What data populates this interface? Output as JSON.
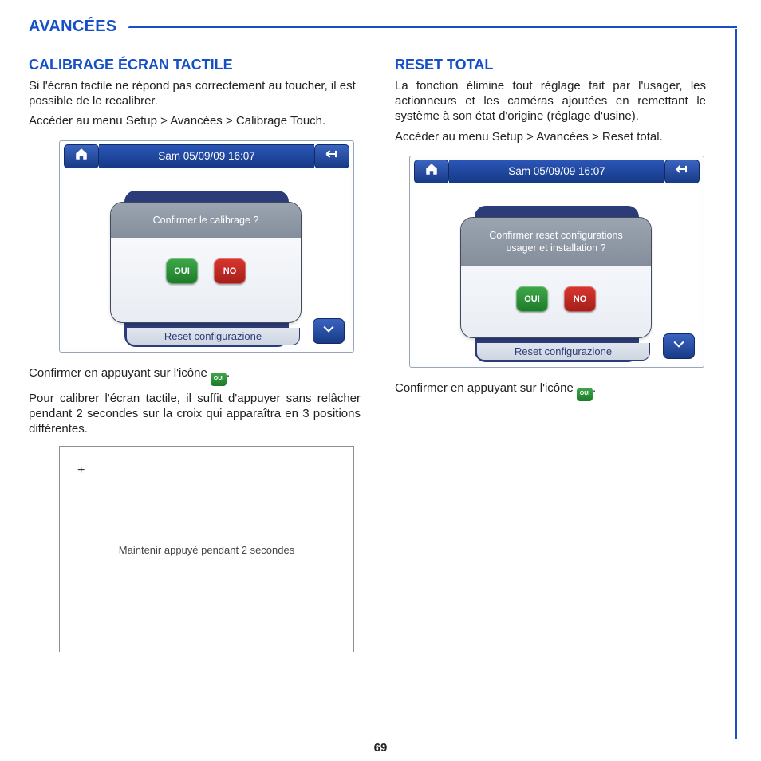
{
  "sectionTitle": "AVANCÉES",
  "pageNumber": "69",
  "left": {
    "heading": "CALIBRAGE ÉCRAN TACTILE",
    "para1": "Si l'écran tactile ne répond pas correctement au toucher, il est possible de le recalibrer.",
    "para2": "Accéder au menu Setup > Avancées > Calibrage Touch.",
    "device": {
      "dateTime": "Sam 05/09/09 16:07",
      "dialogMsg": "Confirmer le calibrage ?",
      "ouiLabel": "OUI",
      "noLabel": "NO",
      "bottomLabel": "Reset configurazione"
    },
    "confirmPrefix": "Confirmer en appuyant sur l'icône ",
    "confirmSuffix": ".",
    "inlineIconLabel": "OUI",
    "para3": "Pour calibrer l'écran tactile, il suffit d'appuyer sans relâcher pendant 2 secondes sur la croix qui apparaîtra en 3 positions différentes.",
    "calibBox": {
      "cross": "+",
      "hold": "Maintenir appuyé pendant 2 secondes"
    }
  },
  "right": {
    "heading": "RESET TOTAL",
    "para1": "La fonction élimine tout réglage fait par l'usager, les actionneurs et les caméras ajoutées en remettant le système à son état d'origine (réglage d'usine).",
    "para2": "Accéder au menu Setup > Avancées > Reset total.",
    "device": {
      "dateTime": "Sam 05/09/09 16:07",
      "dialogLine1": "Confirmer reset configurations",
      "dialogLine2": "usager et installation ?",
      "ouiLabel": "OUI",
      "noLabel": "NO",
      "bottomLabel": "Reset configurazione"
    },
    "confirmPrefix": "Confirmer en appuyant sur l'icône ",
    "confirmSuffix": ".",
    "inlineIconLabel": "OUI"
  }
}
